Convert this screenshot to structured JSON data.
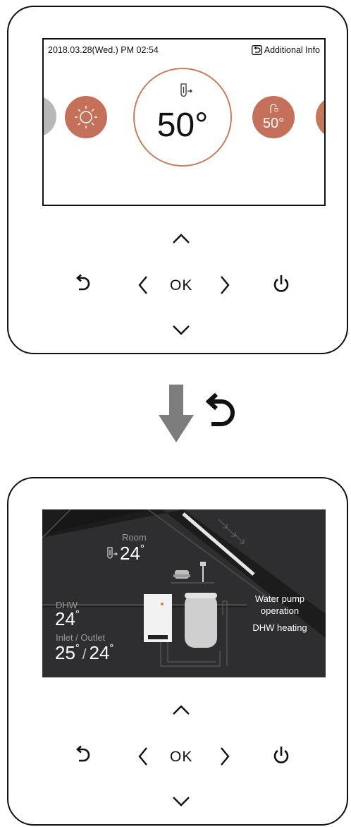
{
  "top_panel": {
    "datetime": "2018.03.28(Wed.) PM 02:54",
    "additional_info_label": "Additional Info",
    "dhw_temperature": "50°",
    "dhw_shower_temperature": "50°",
    "colors": {
      "accent": "#c77e5f",
      "side_gray": "#bdbdbd"
    },
    "icons": [
      "sun-icon",
      "tank-heating-icon",
      "shower-icon",
      "back-icon"
    ]
  },
  "controls": {
    "ok_label": "OK",
    "icons": [
      "up-arrow-icon",
      "down-arrow-icon",
      "left-arrow-icon",
      "right-arrow-icon",
      "back-icon",
      "power-icon"
    ]
  },
  "transition": {
    "icons": [
      "down-arrow-icon",
      "back-icon"
    ]
  },
  "bottom_panel": {
    "room_label": "Room",
    "room_temp": "24",
    "room_unit": "°",
    "dhw_label": "DHW",
    "dhw_temp": "24",
    "dhw_unit": "°",
    "inlet_outlet_label": "Inlet / Outlet",
    "inlet_temp": "25",
    "outlet_temp": "24",
    "temp_unit": "°",
    "separator": "/",
    "status_line1": "Water pump",
    "status_line2": "operation",
    "status_line3": "DHW heating",
    "colors": {
      "background": "#2e2e30",
      "roof": "#1a1a1a"
    }
  }
}
